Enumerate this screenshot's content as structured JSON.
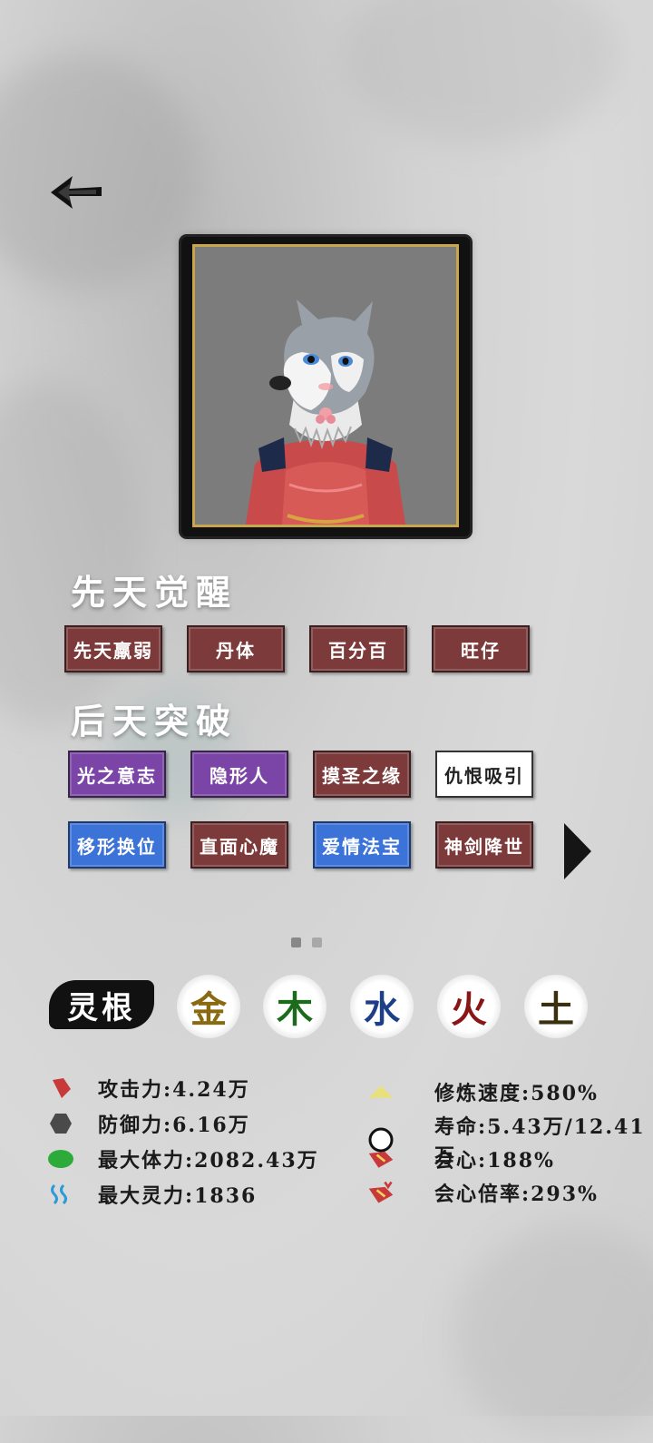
{
  "header": {
    "back_icon": "back-arrow-icon"
  },
  "portrait": {
    "description_icon": "husky-character-portrait"
  },
  "innate": {
    "title": "先天觉醒",
    "tags": [
      "先天羸弱",
      "丹体",
      "百分百",
      "旺仔"
    ]
  },
  "acquired": {
    "title": "后天突破",
    "tags": [
      "光之意志",
      "隐形人",
      "摸圣之缘",
      "仇恨吸引",
      "移形换位",
      "直面心魔",
      "爱情法宝",
      "神剑降世"
    ]
  },
  "spirit_root": {
    "label": "灵根",
    "elements": [
      "金",
      "木",
      "水",
      "火",
      "土"
    ],
    "colors": [
      "#8a6a10",
      "#1c6a1c",
      "#1d3f8a",
      "#8a1515",
      "#3a3010"
    ]
  },
  "stats_left": [
    {
      "icon": "attack-icon",
      "label": "攻击力:4.24万"
    },
    {
      "icon": "defense-icon",
      "label": "防御力:6.16万"
    },
    {
      "icon": "health-icon",
      "label": "最大体力:2082.43万"
    },
    {
      "icon": "spirit-icon",
      "label": "最大灵力:1836"
    }
  ],
  "stats_right": [
    {
      "icon": "cultivation-speed-icon",
      "label": "修炼速度:580%"
    },
    {
      "icon": "lifespan-icon",
      "label": "寿命:5.43万/12.41万"
    },
    {
      "icon": "crit-icon",
      "label": "会心:188%"
    },
    {
      "icon": "crit-multiplier-icon",
      "label": "会心倍率:293%"
    }
  ],
  "pager": {
    "current": 1,
    "total": 2
  }
}
